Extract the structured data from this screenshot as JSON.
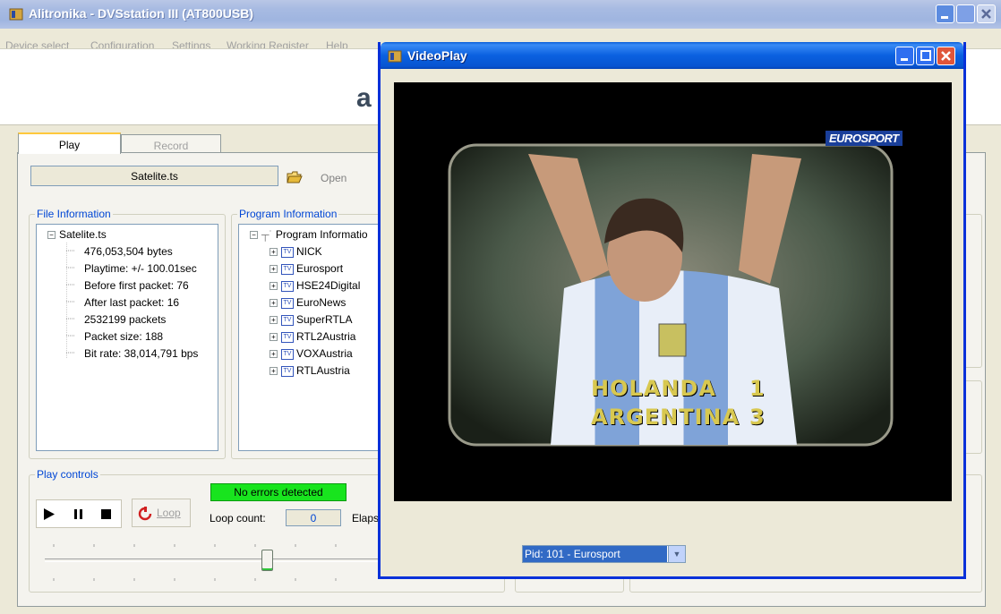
{
  "main_window": {
    "title": "Alitronika - DVSstation III  (AT800USB)",
    "menu": [
      "Device select",
      "Configuration",
      "Settings",
      "Working Register",
      "Help"
    ],
    "logo_letter": "a"
  },
  "tabs": {
    "play": "Play",
    "record": "Record"
  },
  "file": {
    "name": "Satelite.ts",
    "open_label": "Open"
  },
  "file_information": {
    "title": "File Information",
    "root": "Satelite.ts",
    "items": [
      "476,053,504 bytes",
      "Playtime: +/- 100.01sec",
      "Before first packet: 76",
      "After last packet: 16",
      "2532199 packets",
      "Packet size: 188",
      "Bit rate: 38,014,791 bps"
    ]
  },
  "program_information": {
    "title": "Program Information",
    "root": "Program Informatio",
    "tv_badge": "TV",
    "items": [
      "NICK",
      "Eurosport",
      "HSE24Digital",
      "EuroNews",
      "SuperRTLA",
      "RTL2Austria",
      "VOXAustria",
      "RTLAustria"
    ]
  },
  "play_controls": {
    "title": "Play controls",
    "status": "No errors detected",
    "loop_label": "Loop",
    "loop_count_label": "Loop count:",
    "loop_count": "0",
    "elapsed_label_partial": "Elaps"
  },
  "video_window": {
    "title": "VideoPlay",
    "channel_logo": "EUROSPORT",
    "scoreboard": [
      {
        "team": "HOLANDA",
        "score": "1"
      },
      {
        "team": "ARGENTINA",
        "score": "3"
      }
    ],
    "pid_select": "Pid: 101 - Eurosport"
  },
  "colors": {
    "status_ok": "#18e41e",
    "xp_blue": "#0831d9",
    "group_label": "#0046d5"
  }
}
